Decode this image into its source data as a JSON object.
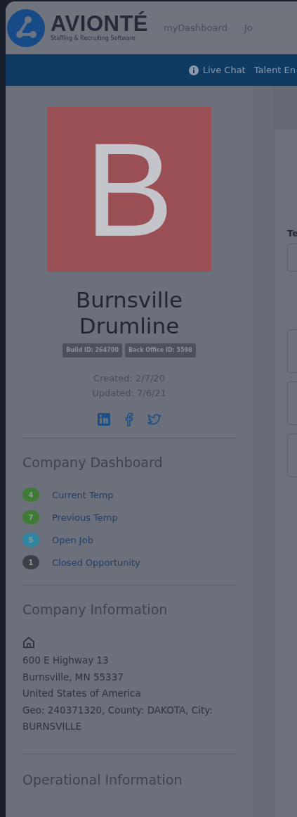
{
  "header": {
    "logo_title": "AVIONTÉ",
    "logo_subtitle": "Staffing & Recruiting Software",
    "nav_items": [
      "myDashboard",
      "Jo"
    ]
  },
  "topbar": {
    "items": [
      {
        "kind": "info",
        "label": "Live Chat"
      },
      {
        "kind": "plain",
        "label": "Talent En"
      }
    ]
  },
  "profile": {
    "avatar_letter": "B",
    "name": "Burnsville Drumline",
    "badges": [
      "Build ID: 264700",
      "Back Office ID: 5598"
    ],
    "created": "Created: 2/7/20",
    "updated": "Updated: 7/6/21",
    "social": [
      {
        "kind": "linkedin"
      },
      {
        "kind": "facebook"
      },
      {
        "kind": "twitter"
      }
    ]
  },
  "company_dashboard": {
    "title": "Company Dashboard",
    "items": [
      {
        "count": "4",
        "label": "Current Temp",
        "color": "#3e7a34"
      },
      {
        "count": "7",
        "label": "Previous Temp",
        "color": "#3e7a34"
      },
      {
        "count": "5",
        "label": "Open Job",
        "color": "#2f87a3"
      },
      {
        "count": "1",
        "label": "Closed Opportunity",
        "color": "#3b3f47"
      }
    ]
  },
  "company_information": {
    "title": "Company Information",
    "address_lines": [
      "600 E Highway 13",
      "Burnsville, MN 55337",
      "United States of America",
      "Geo: 240371320, County: DAKOTA, City: BURNSVILLE"
    ]
  },
  "operational_information": {
    "title": "Operational Information"
  },
  "main_panel": {
    "field_label": "Te"
  }
}
